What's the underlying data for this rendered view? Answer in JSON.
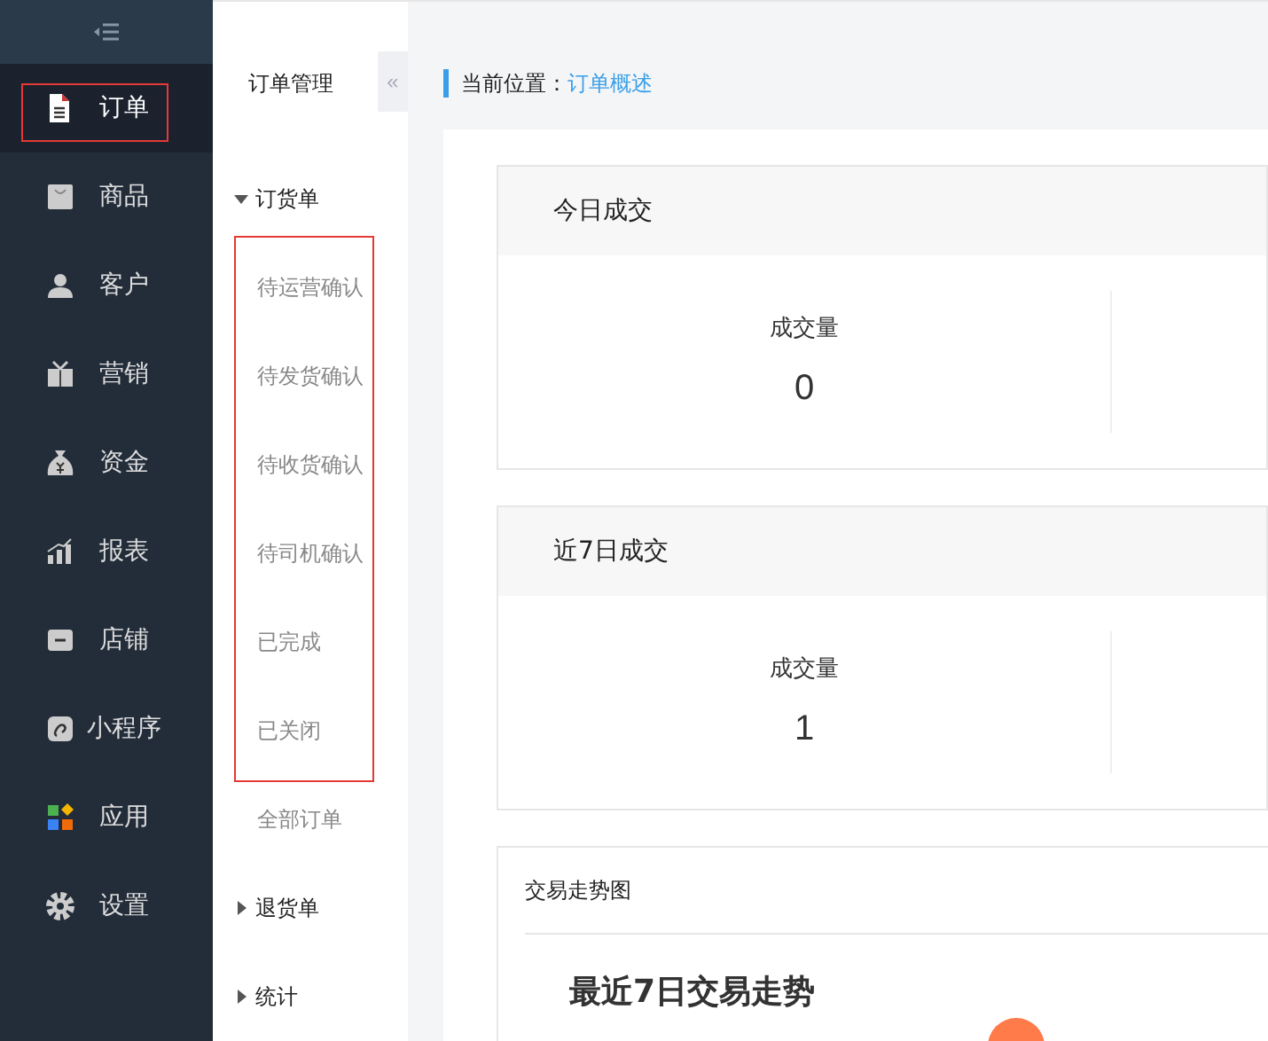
{
  "nav": [
    {
      "label": "订单",
      "selected": true,
      "highlighted": true
    },
    {
      "label": "商品",
      "selected": false,
      "highlighted": false
    },
    {
      "label": "客户",
      "selected": false,
      "highlighted": false
    },
    {
      "label": "营销",
      "selected": false,
      "highlighted": false
    },
    {
      "label": "资金",
      "selected": false,
      "highlighted": false
    },
    {
      "label": "报表",
      "selected": false,
      "highlighted": false
    },
    {
      "label": "店铺",
      "selected": false,
      "highlighted": false
    },
    {
      "label": "小程序",
      "selected": false,
      "highlighted": false
    },
    {
      "label": "应用",
      "selected": false,
      "highlighted": false
    },
    {
      "label": "设置",
      "selected": false,
      "highlighted": false
    }
  ],
  "submenu": {
    "title": "订单管理",
    "collapse": "«",
    "groups": [
      {
        "label": "订货单",
        "expanded": true,
        "highlighted": true,
        "children": [
          {
            "label": "待运营确认"
          },
          {
            "label": "待发货确认"
          },
          {
            "label": "待收货确认"
          },
          {
            "label": "待司机确认"
          },
          {
            "label": "已完成"
          },
          {
            "label": "已关闭"
          }
        ],
        "extra": [
          {
            "label": "全部订单"
          }
        ]
      },
      {
        "label": "退货单",
        "expanded": false
      },
      {
        "label": "统计",
        "expanded": false
      }
    ]
  },
  "breadcrumb": {
    "label": "当前位置：",
    "current": "订单概述"
  },
  "cards": [
    {
      "title": "今日成交",
      "stats": [
        {
          "label": "成交量",
          "value": "0"
        }
      ]
    },
    {
      "title": "近7日成交",
      "stats": [
        {
          "label": "成交量",
          "value": "1"
        }
      ]
    }
  ],
  "trend": {
    "title": "交易走势图",
    "heading": "最近7日交易走势"
  }
}
